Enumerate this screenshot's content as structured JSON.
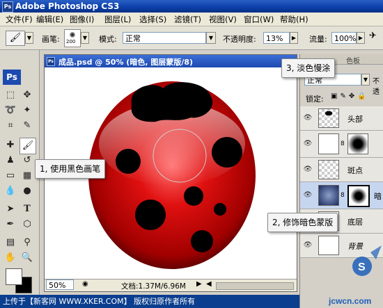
{
  "app": {
    "title": "Adobe Photoshop CS3"
  },
  "menu": [
    {
      "label": "文件(F)"
    },
    {
      "label": "编辑(E)"
    },
    {
      "label": "图像(I)"
    },
    {
      "label": "图层(L)"
    },
    {
      "label": "选择(S)"
    },
    {
      "label": "滤镜(T)"
    },
    {
      "label": "视图(V)"
    },
    {
      "label": "窗口(W)"
    },
    {
      "label": "帮助(H)"
    }
  ],
  "options": {
    "brush_label": "画笔:",
    "brush_size": "200",
    "mode_label": "模式:",
    "mode_value": "正常",
    "opacity_label": "不透明度:",
    "opacity_value": "13%",
    "flow_label": "流量:",
    "flow_value": "100%"
  },
  "document": {
    "title": "成品.psd @ 50% (暗色, 图层蒙版/8)",
    "zoom": "50%",
    "doc_size": "文档:1.37M/6.96M"
  },
  "layers_panel": {
    "blend_mode": "正常",
    "opacity_label": "不透",
    "lock_label": "锁定:",
    "tab_label": "色板",
    "layers": [
      {
        "name": "头部"
      },
      {
        "name": ""
      },
      {
        "name": "斑点"
      },
      {
        "name": "暗"
      },
      {
        "name": "底层"
      },
      {
        "name": "背景"
      }
    ]
  },
  "callouts": {
    "step1": "1, 使用黑色画笔",
    "step2": "2, 修饰暗色蒙版",
    "step3": "3, 淡色慢涂"
  },
  "footer": {
    "text": "上传于【新客网 WWW.XKER.COM】 版权归原作者所有"
  },
  "watermark": {
    "text": "jcwcn.com"
  },
  "colors": {
    "titlebar": "#0b3fa8",
    "ladybug_red": "#d40000",
    "spot": "#000000"
  }
}
